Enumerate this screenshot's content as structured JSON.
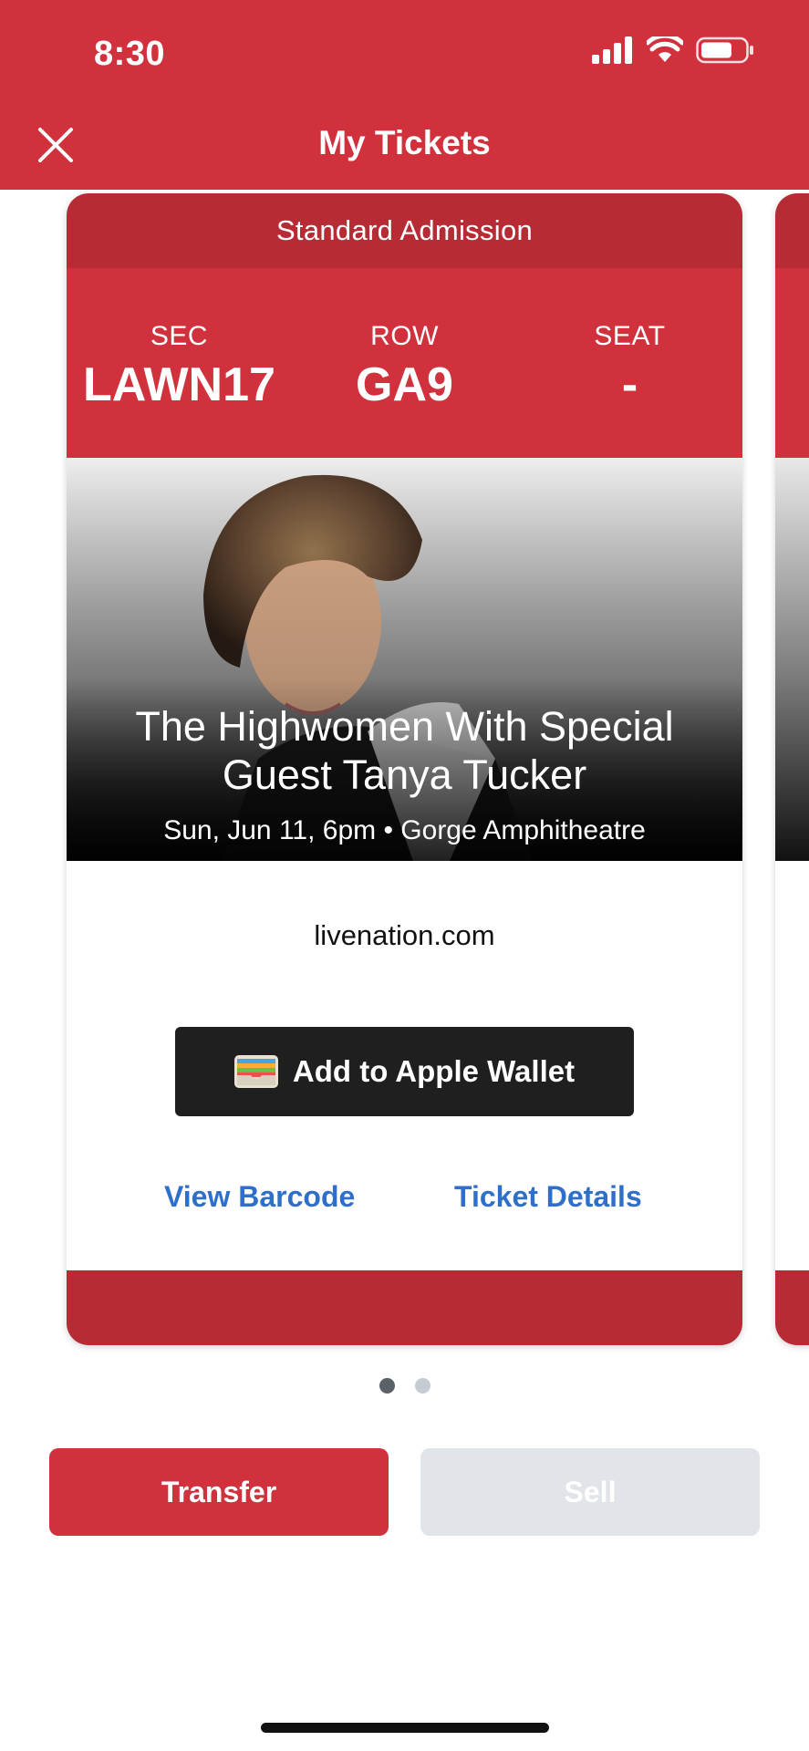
{
  "status_bar": {
    "time": "8:30",
    "icons": [
      "signal-icon",
      "wifi-icon",
      "battery-icon"
    ]
  },
  "nav": {
    "title": "My Tickets",
    "close_icon": "close-icon"
  },
  "ticket": {
    "admission": "Standard Admission",
    "section_label": "SEC",
    "section_value": "LAWN17",
    "row_label": "ROW",
    "row_value": "GA9",
    "seat_label": "SEAT",
    "seat_value": "-",
    "event_title": "The Highwomen With Special Guest Tanya Tucker",
    "event_details": "Sun, Jun 11, 6pm • Gorge Amphitheatre",
    "provider": "livenation.com",
    "wallet_button": "Add to Apple Wallet",
    "view_barcode": "View Barcode",
    "ticket_details": "Ticket Details"
  },
  "pager": {
    "count": 2,
    "active_index": 0
  },
  "actions": {
    "transfer": "Transfer",
    "sell": "Sell"
  },
  "colors": {
    "brand_red": "#d0313d",
    "dark_red": "#b72b35",
    "link_blue": "#2f6fc9",
    "disabled_gray": "#e1e4e8"
  }
}
